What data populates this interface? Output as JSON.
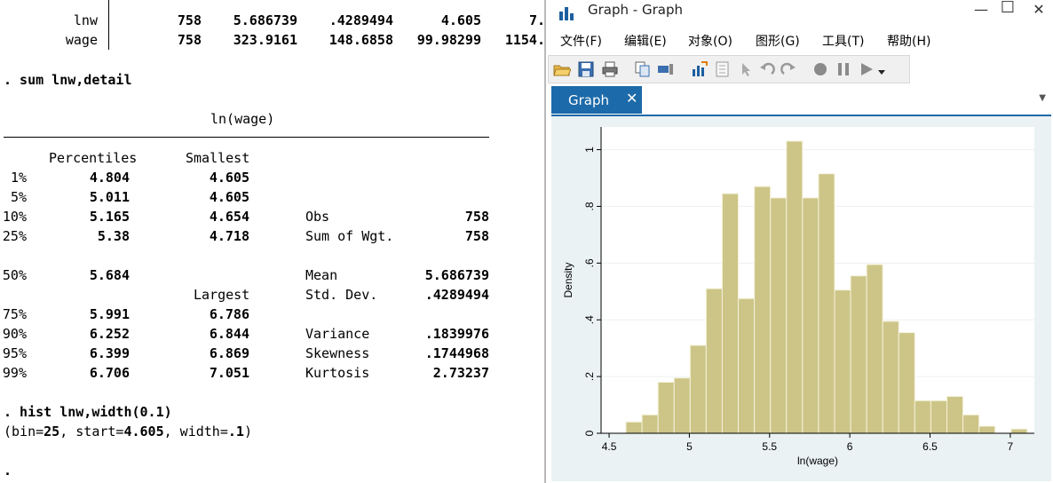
{
  "console": {
    "summary_rows": [
      {
        "var": "lnw",
        "obs": "758",
        "mean": "5.686739",
        "sd": ".4289494",
        "min": "4.605",
        "max": "7."
      },
      {
        "var": "wage",
        "obs": "758",
        "mean": "323.9161",
        "sd": "148.6858",
        "min": "99.98299",
        "max": "1154."
      }
    ],
    "cmd_sum": ". sum lnw,detail",
    "var_title": "ln(wage)",
    "headers": {
      "percentiles": "Percentiles",
      "smallest": "Smallest",
      "largest": "Largest"
    },
    "rows": [
      {
        "p": "1%",
        "pct": "4.804",
        "ext": "4.605",
        "stat": "",
        "val": ""
      },
      {
        "p": "5%",
        "pct": "5.011",
        "ext": "4.605",
        "stat": "",
        "val": ""
      },
      {
        "p": "10%",
        "pct": "5.165",
        "ext": "4.654",
        "stat": "Obs",
        "val": "758"
      },
      {
        "p": "25%",
        "pct": "5.38",
        "ext": "4.718",
        "stat": "Sum of Wgt.",
        "val": "758"
      },
      {
        "p": "50%",
        "pct": "5.684",
        "ext": "",
        "stat": "Mean",
        "val": "5.686739"
      },
      {
        "p": "",
        "pct": "",
        "ext": "",
        "stat": "Std. Dev.",
        "val": ".4289494"
      },
      {
        "p": "75%",
        "pct": "5.991",
        "ext": "6.786",
        "stat": "",
        "val": ""
      },
      {
        "p": "90%",
        "pct": "6.252",
        "ext": "6.844",
        "stat": "Variance",
        "val": ".1839976"
      },
      {
        "p": "95%",
        "pct": "6.399",
        "ext": "6.869",
        "stat": "Skewness",
        "val": ".1744968"
      },
      {
        "p": "99%",
        "pct": "6.706",
        "ext": "7.051",
        "stat": "Kurtosis",
        "val": "2.73237"
      }
    ],
    "cmd_hist": ". hist lnw,width(0.1)",
    "bin_info": "(bin=25, start=4.605, width=.1)",
    "prompt": "."
  },
  "graph_window": {
    "title": "Graph - Graph",
    "controls": {
      "minimize": "—",
      "maximize": "☐",
      "close": "✕"
    },
    "menu": [
      "文件(F)",
      "编辑(E)",
      "对象(O)",
      "图形(G)",
      "工具(T)",
      "帮助(H)"
    ],
    "tab_label": "Graph",
    "tab_close": "✕",
    "tab_menu": "▼",
    "colors": {
      "bar_fill": "#cdc587",
      "bar_stroke": "#f4f2dc",
      "plot_bg": "#ffffff",
      "frame_bg": "#eaf2f3",
      "tab_bg": "#1c6aa9"
    }
  },
  "chart_data": {
    "type": "bar",
    "xlabel": "ln(wage)",
    "ylabel": "Density",
    "xlim": [
      4.45,
      7.15
    ],
    "ylim": [
      0,
      1.08
    ],
    "xticks": [
      4.5,
      5,
      5.5,
      6,
      6.5,
      7
    ],
    "xtick_labels": [
      "4.5",
      "5",
      "5.5",
      "6",
      "6.5",
      "7"
    ],
    "yticks": [
      0,
      0.2,
      0.4,
      0.6,
      0.8,
      1
    ],
    "ytick_labels": [
      "0",
      ".2",
      ".4",
      ".6",
      ".8",
      "1"
    ],
    "bin_start": 4.605,
    "bin_width": 0.1,
    "values": [
      0.04,
      0.065,
      0.18,
      0.195,
      0.31,
      0.51,
      0.845,
      0.475,
      0.87,
      0.83,
      1.03,
      0.83,
      0.915,
      0.505,
      0.555,
      0.595,
      0.395,
      0.355,
      0.115,
      0.115,
      0.13,
      0.065,
      0.025,
      0,
      0.015
    ],
    "grid": true
  }
}
